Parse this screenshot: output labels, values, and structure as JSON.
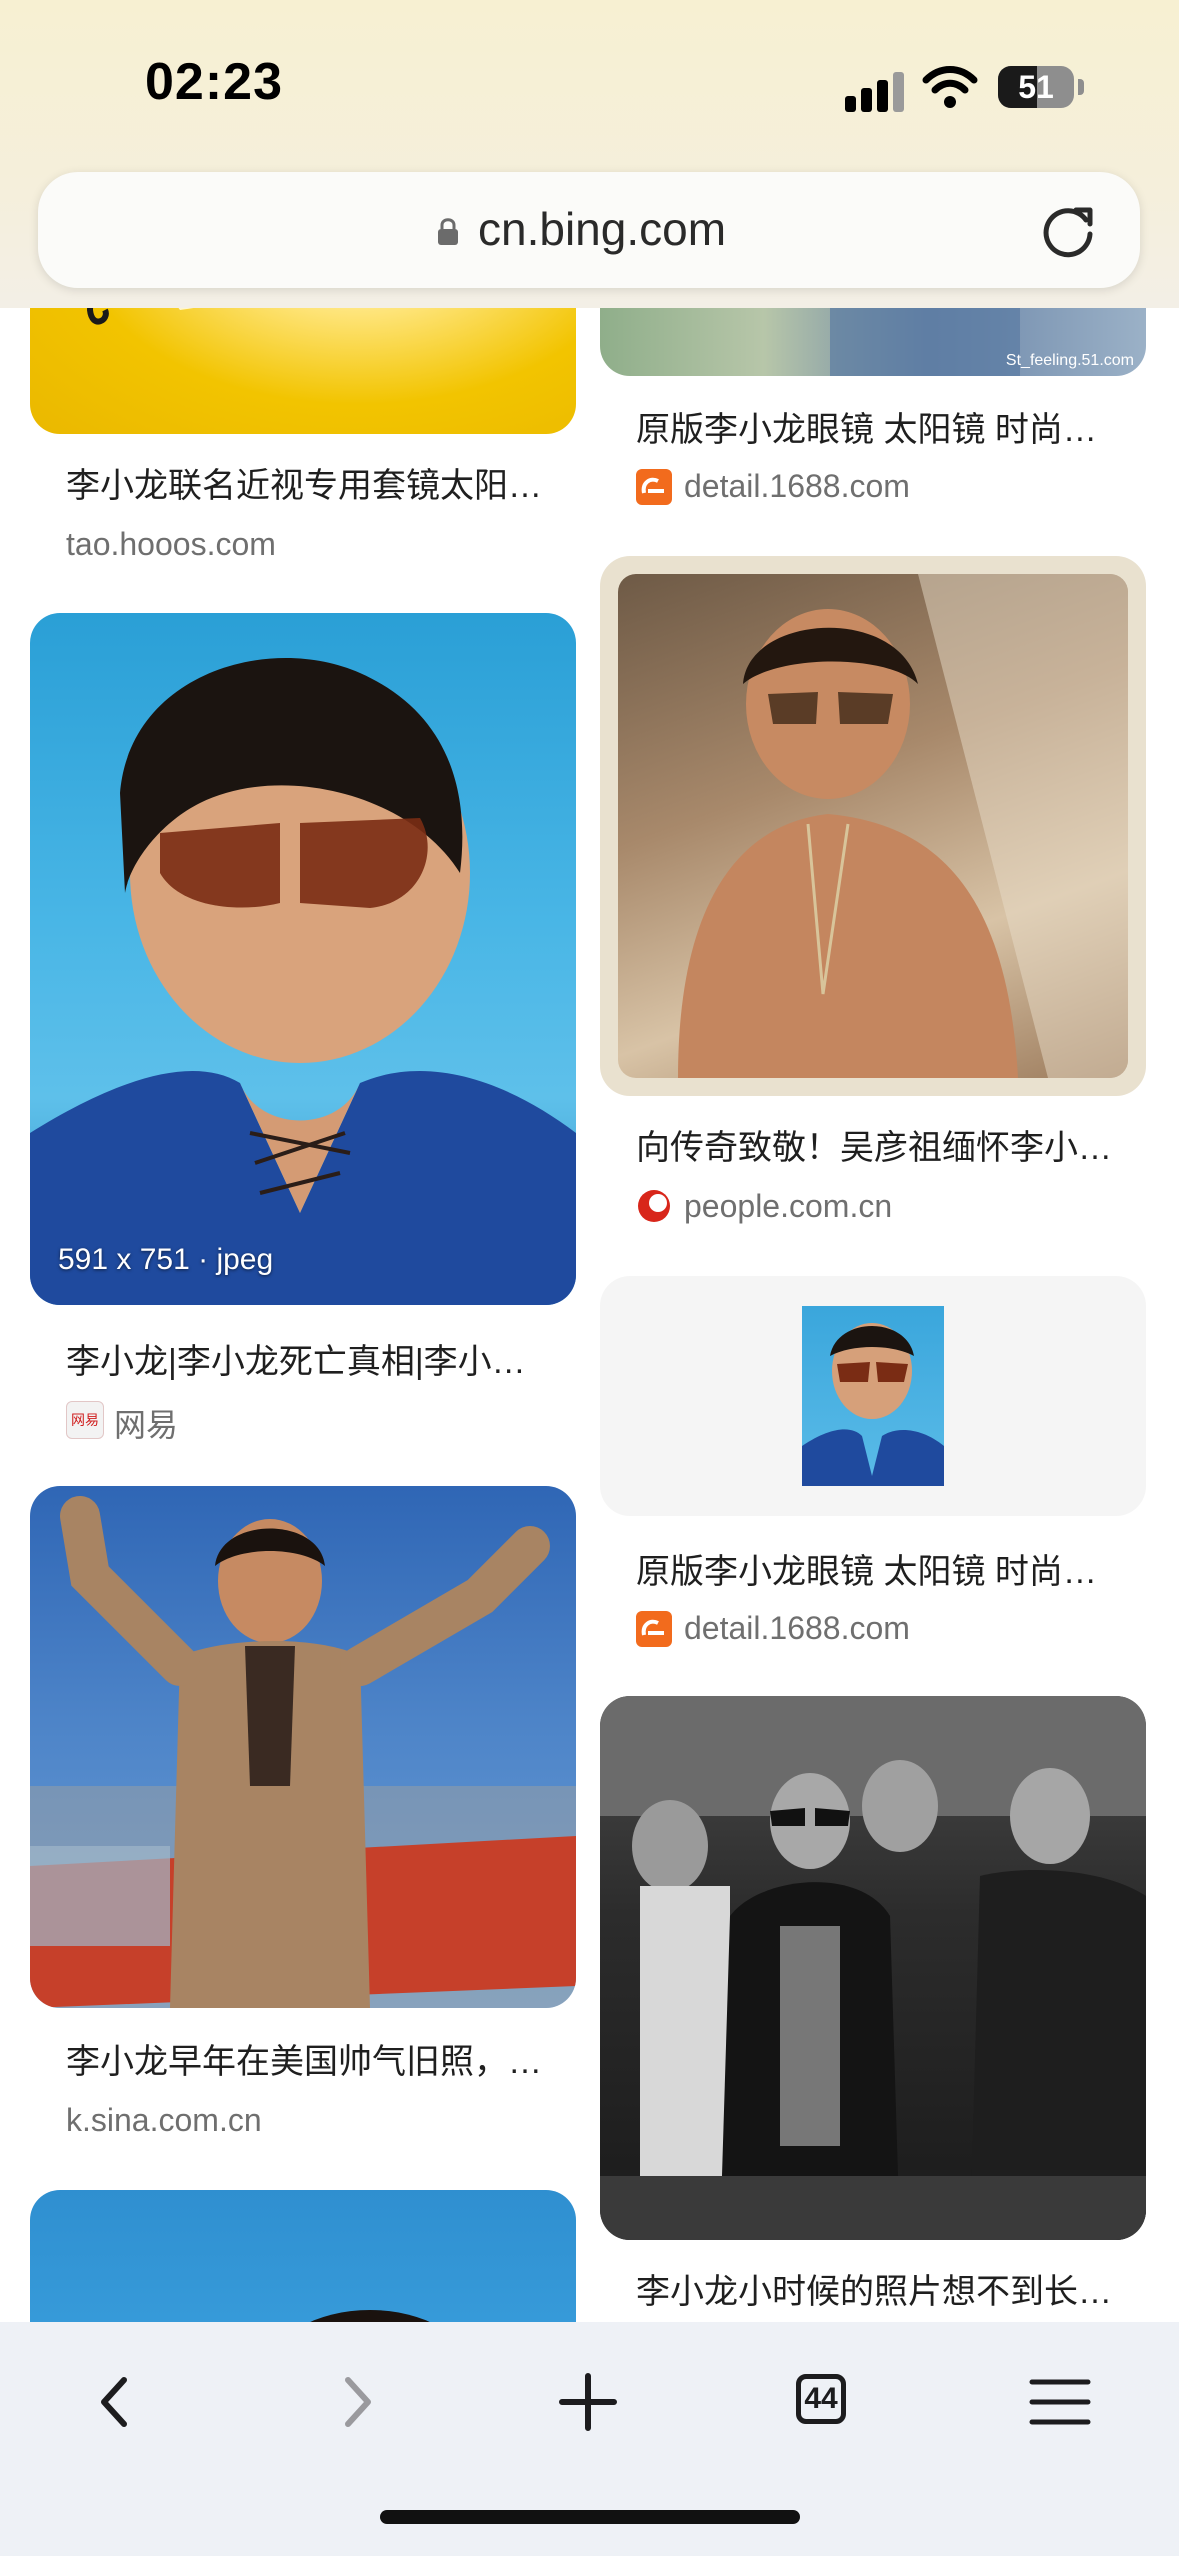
{
  "status_bar": {
    "time": "02:23",
    "battery": "51"
  },
  "url_bar": {
    "domain": "cn.bing.com",
    "icons": [
      "lock-icon",
      "reload-icon"
    ]
  },
  "results": [
    {
      "column": "left",
      "title": "李小龙联名近视专用套镜太阳…",
      "source": "tao.hooos.com"
    },
    {
      "column": "left",
      "title": "李小龙|李小龙死亡真相|李小…",
      "source": "网易",
      "overlay": "591 x 751 · jpeg",
      "favicon_text": "网易"
    },
    {
      "column": "left",
      "title": "李小龙早年在美国帅气旧照，…",
      "source": "k.sina.com.cn"
    },
    {
      "column": "right",
      "title": "原版李小龙眼镜 太阳镜 时尚…",
      "source": "detail.1688.com",
      "watermark": "St_feeling.51.com"
    },
    {
      "column": "right",
      "title": "向传奇致敬！吴彦祖缅怀李小…",
      "source": "people.com.cn"
    },
    {
      "column": "right",
      "title": "原版李小龙眼镜 太阳镜 时尚…",
      "source": "detail.1688.com"
    },
    {
      "column": "right",
      "title": "李小龙小时候的照片想不到长…",
      "source": ""
    }
  ],
  "toolbar": {
    "tabs_count": "44",
    "icons": [
      "back-icon",
      "forward-icon",
      "new-tab-icon",
      "tabs-icon",
      "menu-icon"
    ]
  },
  "colors": {
    "accent_1688": "#f26b1d",
    "people_red": "#d8261a"
  }
}
